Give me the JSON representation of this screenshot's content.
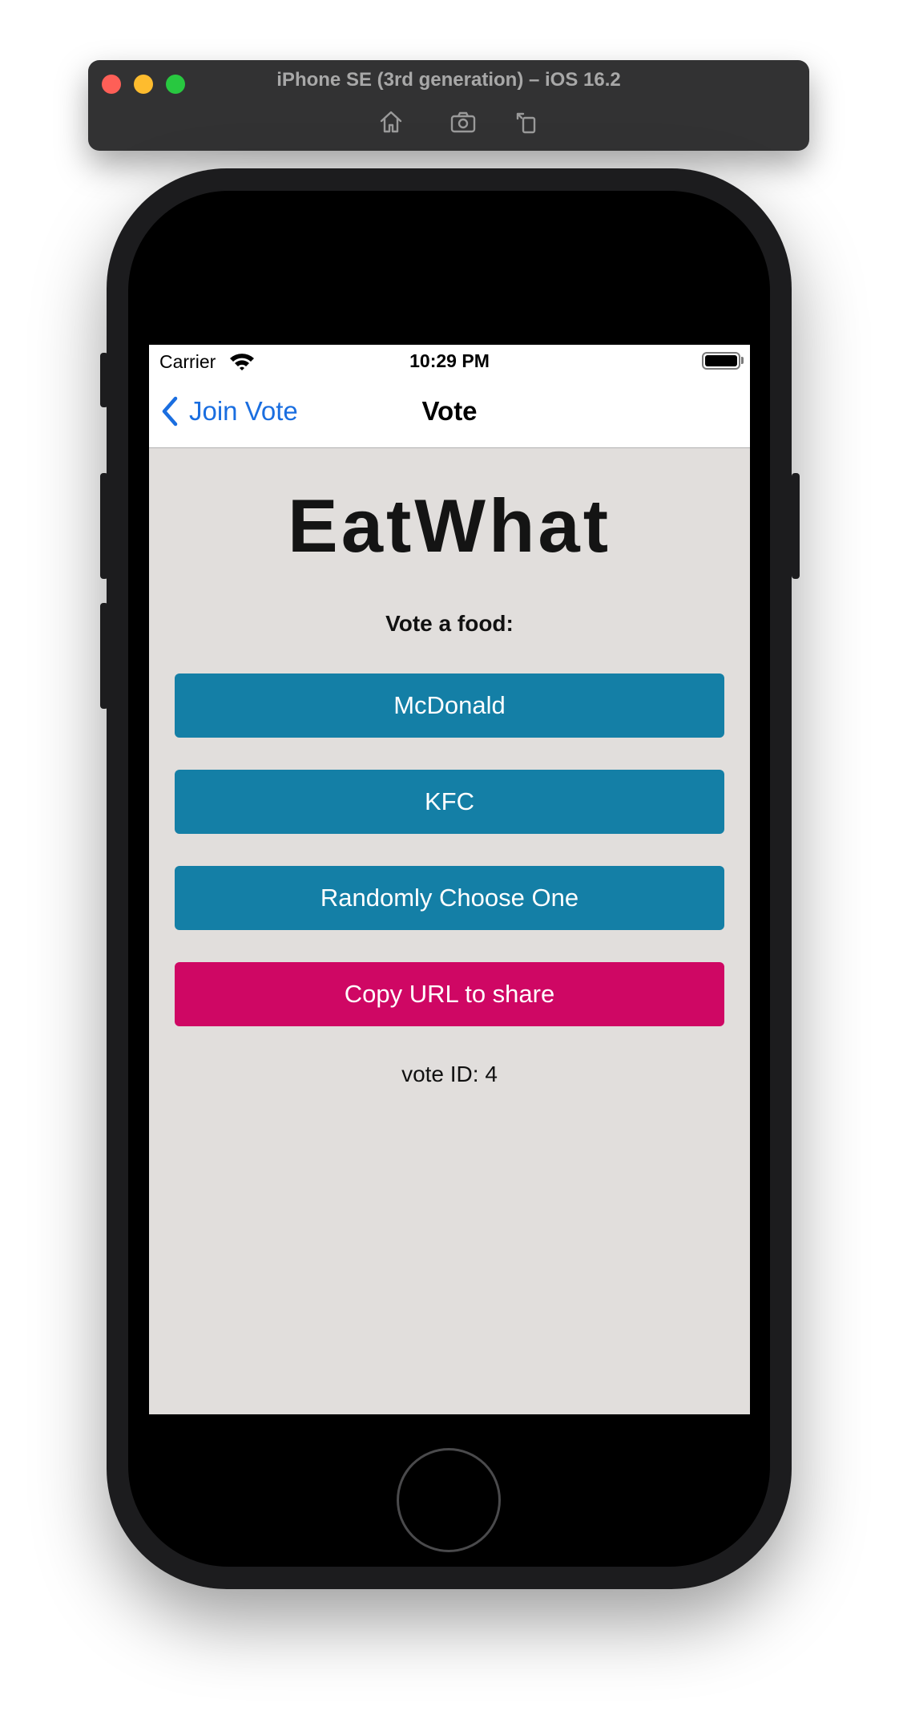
{
  "simulator": {
    "title": "iPhone SE (3rd generation) – iOS 16.2",
    "tools": [
      "home-icon",
      "screenshot-icon",
      "rotate-icon"
    ]
  },
  "status_bar": {
    "carrier": "Carrier",
    "time": "10:29 PM",
    "battery_level": 1.0
  },
  "nav": {
    "back_label": "Join Vote",
    "title": "Vote"
  },
  "main": {
    "app_title": "EatWhat",
    "prompt": "Vote a food:",
    "options": [
      {
        "label": "McDonald"
      },
      {
        "label": "KFC"
      },
      {
        "label": "Randomly Choose One"
      }
    ],
    "share_button": "Copy URL to share",
    "vote_id": "vote ID: 4"
  },
  "colors": {
    "accent_blue": "#1a6ee0",
    "option_button": "#147fa6",
    "share_button": "#cf0764",
    "background": "#e1dedc"
  }
}
